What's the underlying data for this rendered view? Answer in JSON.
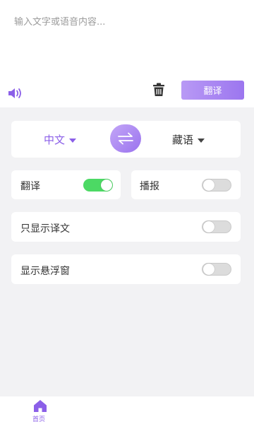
{
  "input": {
    "placeholder": "输入文字或语音内容...",
    "value": ""
  },
  "toolbar": {
    "translate_label": "翻译",
    "speaker_icon": "speaker-icon",
    "trash_icon": "trash-icon"
  },
  "languages": {
    "source": "中文",
    "target": "藏语",
    "swap_icon": "swap-arrows-icon"
  },
  "options": {
    "translate": {
      "label": "翻译",
      "enabled": true
    },
    "broadcast": {
      "label": "播报",
      "enabled": false
    },
    "show_translation_only": {
      "label": "只显示译文",
      "enabled": false
    },
    "show_floating_window": {
      "label": "显示悬浮窗",
      "enabled": false
    }
  },
  "nav": {
    "home_label": "首页",
    "home_icon": "home-icon"
  },
  "colors": {
    "accent": "#8b5fe8",
    "toggle_on": "#4cd964",
    "toggle_off": "#dcdcdc"
  }
}
